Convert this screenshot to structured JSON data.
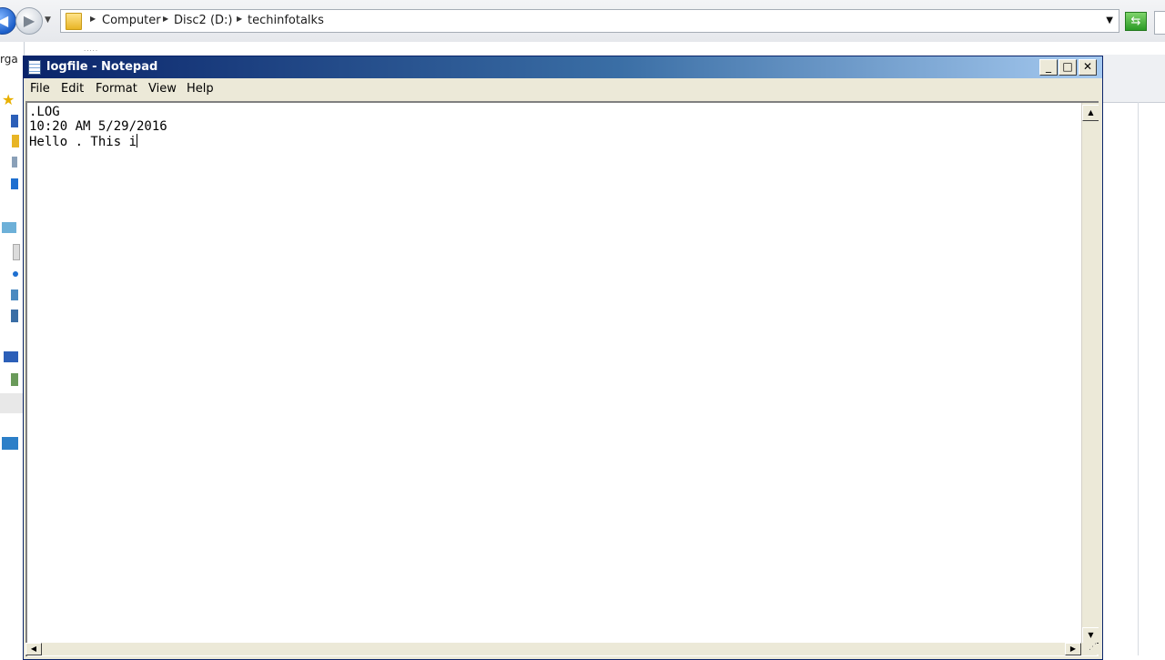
{
  "explorer": {
    "breadcrumbs": [
      "Computer",
      "Disc2 (D:)",
      "techinfotalks"
    ],
    "left_pane_label": "rga"
  },
  "notepad": {
    "title": "logfile - Notepad",
    "menu": [
      "File",
      "Edit",
      "Format",
      "View",
      "Help"
    ],
    "caption_buttons": {
      "minimize": "_",
      "maximize": "□",
      "close": "✕"
    },
    "lines": [
      ".LOG",
      "10:20 AM 5/29/2016",
      "Hello . This i"
    ]
  },
  "icons": {
    "back": "back-arrow-icon",
    "forward": "forward-arrow-icon",
    "refresh": "refresh-icon",
    "folder": "folder-icon",
    "notepad": "notepad-icon"
  },
  "colors": {
    "titlebar_start": "#0a246a",
    "titlebar_end": "#a6caf0",
    "window_face": "#ece9d8"
  }
}
